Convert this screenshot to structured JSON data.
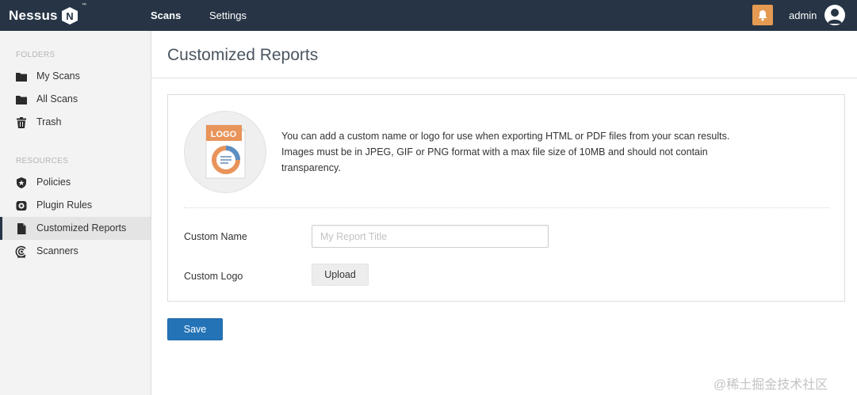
{
  "app": {
    "logo_text": "Nessus",
    "logo_badge": "N",
    "logo_tm": "™"
  },
  "topnav": {
    "scans_label": "Scans",
    "settings_label": "Settings",
    "user_name": "admin",
    "bell_color": "#e59a52",
    "bar_color": "#263445"
  },
  "sidebar": {
    "folders_heading": "FOLDERS",
    "folders": [
      {
        "label": "My Scans",
        "icon": "folder-icon"
      },
      {
        "label": "All Scans",
        "icon": "folder-icon"
      },
      {
        "label": "Trash",
        "icon": "trash-icon"
      }
    ],
    "resources_heading": "RESOURCES",
    "resources": [
      {
        "label": "Policies",
        "icon": "shield-icon"
      },
      {
        "label": "Plugin Rules",
        "icon": "plugin-rules-icon"
      },
      {
        "label": "Customized Reports",
        "icon": "document-icon",
        "active": true
      },
      {
        "label": "Scanners",
        "icon": "scanner-icon"
      }
    ]
  },
  "main": {
    "title": "Customized Reports",
    "logo_placeholder_text": "LOGO",
    "info_line1": "You can add a custom name or logo for use when exporting HTML or PDF files from your scan results.",
    "info_line2": "Images must be in JPEG, GIF or PNG format with a max file size of 10MB and should not contain",
    "info_line3": "transparency.",
    "custom_name_label": "Custom Name",
    "custom_name_value": "",
    "custom_name_placeholder": "My Report Title",
    "custom_logo_label": "Custom Logo",
    "upload_label": "Upload",
    "save_label": "Save",
    "accent_color": "#2473b7"
  },
  "watermark": "@稀土掘金技术社区"
}
